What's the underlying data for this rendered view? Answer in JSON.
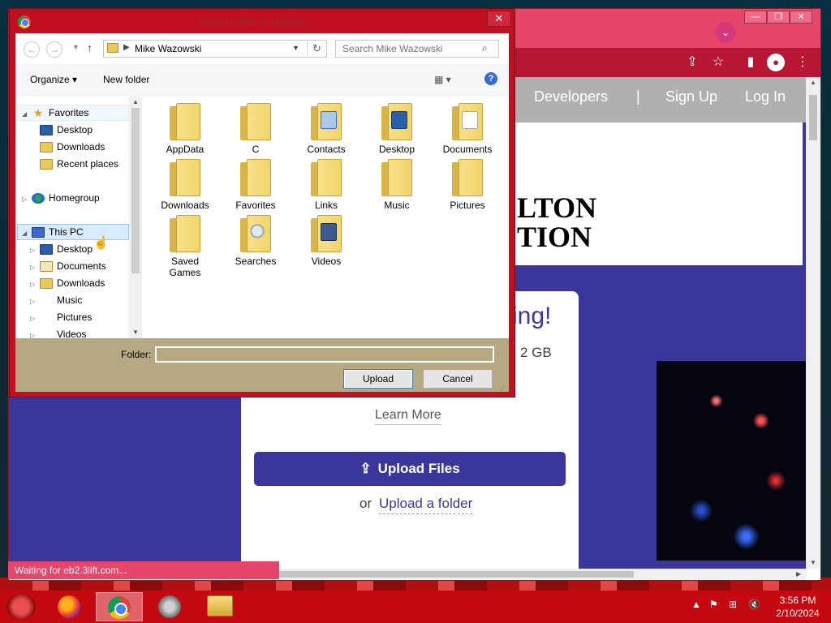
{
  "browser": {
    "site_nav": {
      "developers": "Developers",
      "separator": "|",
      "sign_up": "Sign Up",
      "log_in": "Log In"
    },
    "hero": {
      "line1": "LTON",
      "line2": "TION"
    },
    "card": {
      "heading": "ing!",
      "size_text": "2 GB",
      "learn_more": "Learn More",
      "upload_files": "Upload Files",
      "or": "or",
      "upload_folder": "Upload a folder"
    },
    "status": "Waiting for eb2.3lift.com..."
  },
  "dialog": {
    "title": "Select folder to Upload",
    "address": "Mike Wazowski",
    "search_placeholder": "Search Mike Wazowski",
    "organize": "Organize ▾",
    "new_folder": "New folder",
    "tree": [
      {
        "label": "Favorites",
        "icon": "star-icon"
      },
      {
        "label": "Desktop",
        "icon": "desktop-icon"
      },
      {
        "label": "Downloads",
        "icon": "downloads-icon"
      },
      {
        "label": "Recent places",
        "icon": "recent-places-icon"
      },
      {
        "label": "Homegroup",
        "icon": "homegroup-icon"
      },
      {
        "label": "This PC",
        "icon": "pc-icon"
      },
      {
        "label": "Desktop",
        "icon": "desktop-icon"
      },
      {
        "label": "Documents",
        "icon": "documents-icon"
      },
      {
        "label": "Downloads",
        "icon": "downloads-icon"
      },
      {
        "label": "Music",
        "icon": "music-icon"
      },
      {
        "label": "Pictures",
        "icon": "pictures-icon"
      },
      {
        "label": "Videos",
        "icon": "videos-icon"
      }
    ],
    "folders": [
      {
        "label": "AppData",
        "overlay": ""
      },
      {
        "label": "C",
        "overlay": ""
      },
      {
        "label": "Contacts",
        "overlay": "ov-contacts"
      },
      {
        "label": "Desktop",
        "overlay": "ov-desktop"
      },
      {
        "label": "Documents",
        "overlay": "ov-docs"
      },
      {
        "label": "Downloads",
        "overlay": ""
      },
      {
        "label": "Favorites",
        "overlay": ""
      },
      {
        "label": "Links",
        "overlay": ""
      },
      {
        "label": "Music",
        "overlay": ""
      },
      {
        "label": "Pictures",
        "overlay": ""
      },
      {
        "label": "Saved Games",
        "overlay": ""
      },
      {
        "label": "Searches",
        "overlay": "ov-search"
      },
      {
        "label": "Videos",
        "overlay": "ov-video"
      }
    ],
    "folder_label": "Folder:",
    "folder_value": "",
    "upload_button": "Upload",
    "cancel_button": "Cancel"
  },
  "taskbar": {
    "apps": [
      "firefox-icon",
      "chrome-icon",
      "flash-icon",
      "file-explorer-icon"
    ],
    "time": "3:56 PM",
    "date": "2/10/2024"
  },
  "colors": {
    "dialog_frame": "#c01020",
    "browser_accent": "#e8456b",
    "site_primary": "#3b369c",
    "footer_bar": "#b6a882",
    "taskbar": "#c40a10"
  }
}
